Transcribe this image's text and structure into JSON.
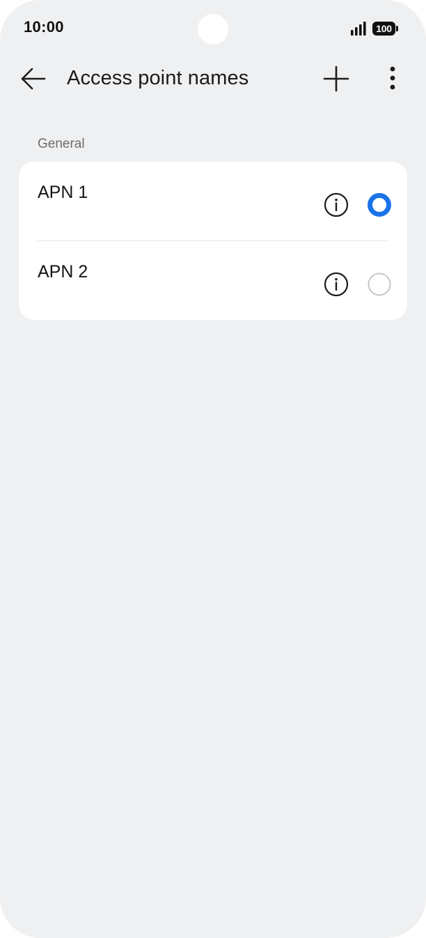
{
  "status_bar": {
    "time": "10:00",
    "battery_level": "100",
    "signal_icon": "signal-bars-icon"
  },
  "app_bar": {
    "title": "Access point names",
    "back_icon": "arrow-left-icon",
    "add_icon": "plus-icon",
    "more_icon": "more-vertical-icon"
  },
  "section": {
    "header": "General"
  },
  "apns": [
    {
      "name": "APN 1",
      "selected": true
    },
    {
      "name": "APN 2",
      "selected": false
    }
  ],
  "colors": {
    "background": "#eff0f2",
    "card": "#ffffff",
    "accent": "#1a73e8",
    "radio_unselected": "#c6c6c6",
    "text_primary": "#151515",
    "text_secondary": "#6d6d6d"
  }
}
